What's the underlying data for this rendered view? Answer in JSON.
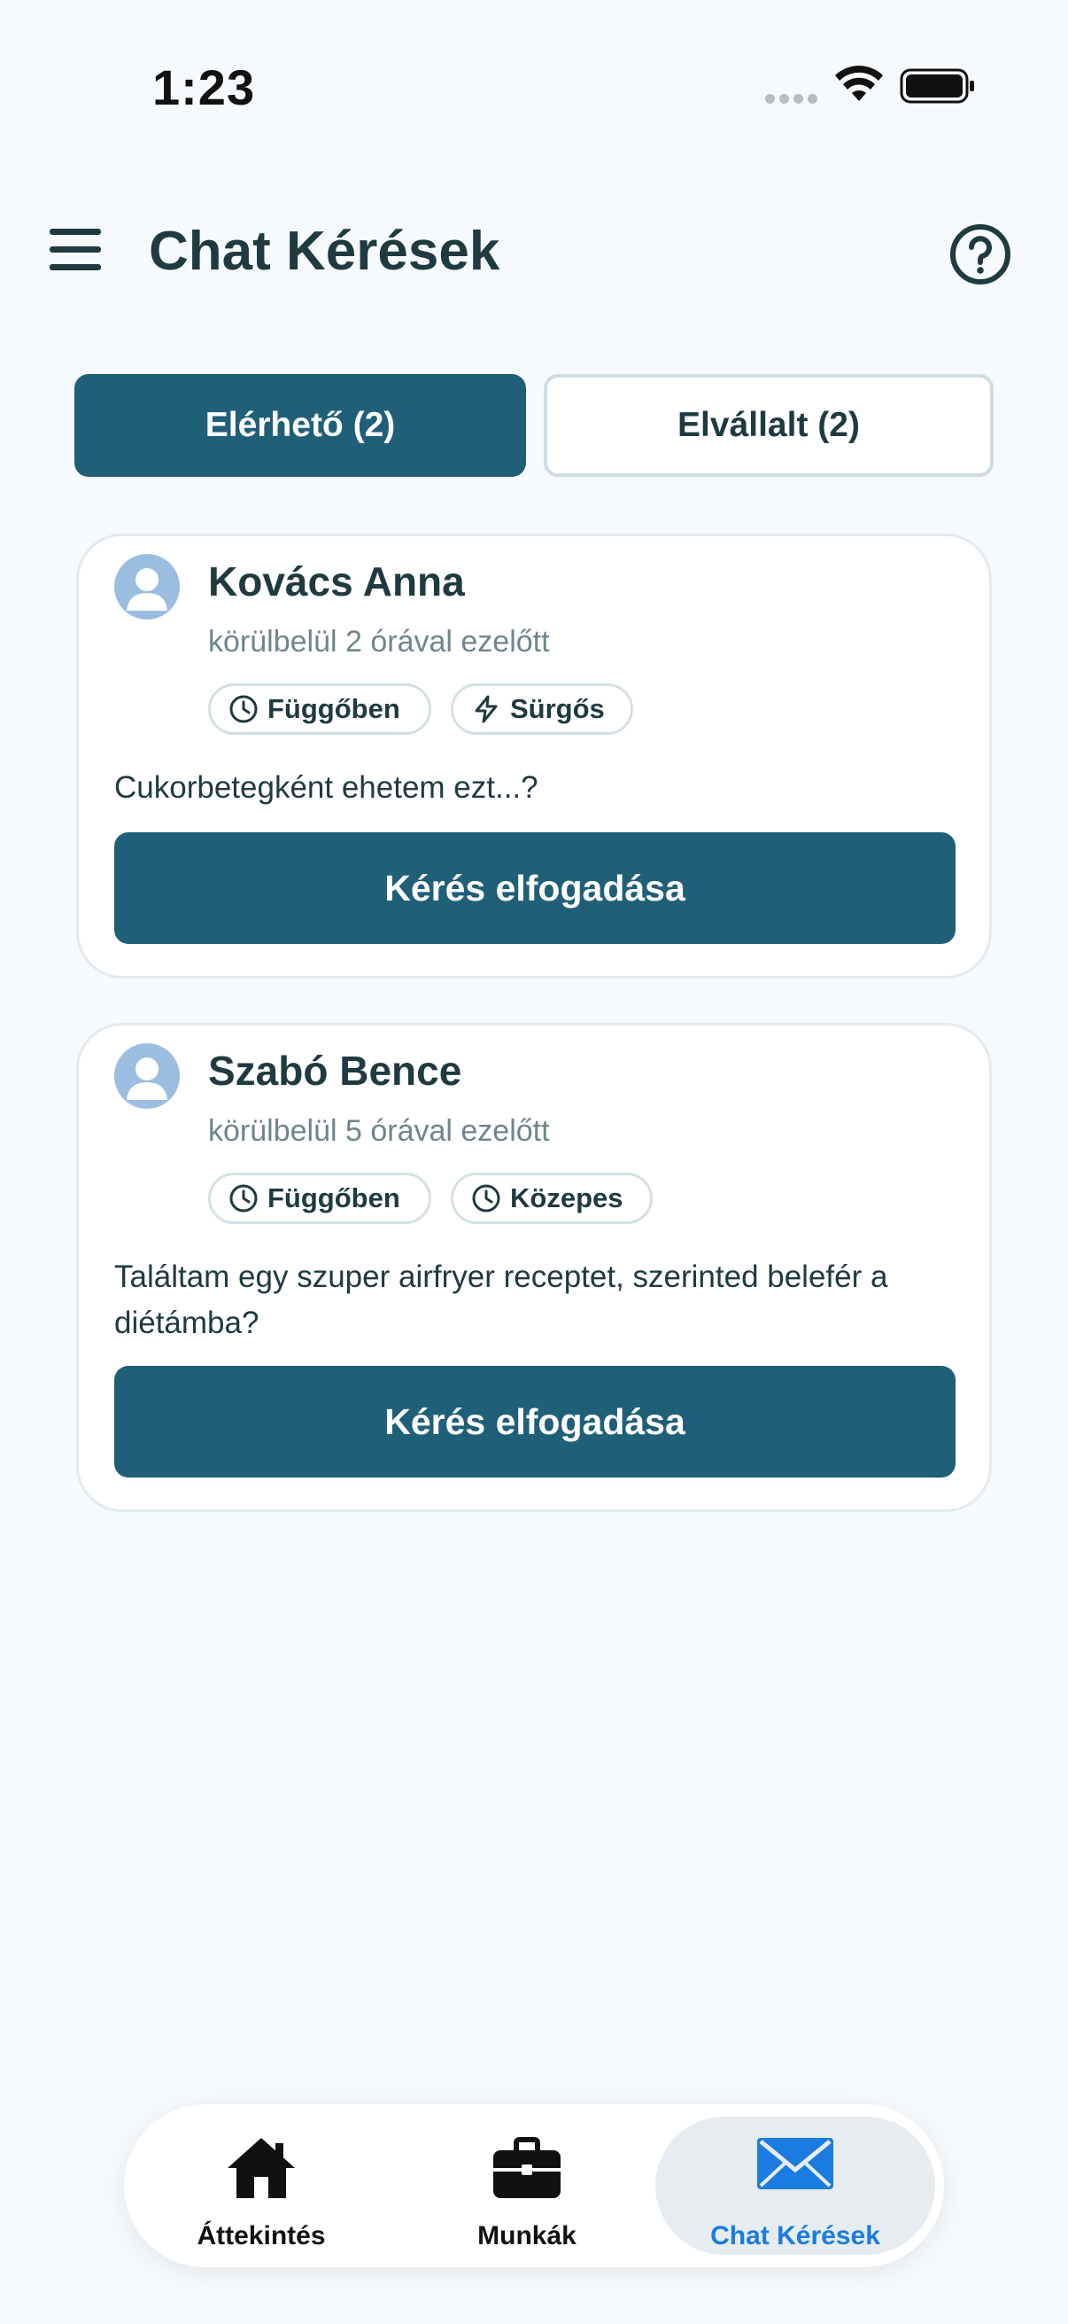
{
  "status_bar": {
    "time": "1:23"
  },
  "header": {
    "title": "Chat Kérések"
  },
  "tabs": [
    {
      "label": "Elérhető (2)",
      "active": true
    },
    {
      "label": "Elvállalt (2)",
      "active": false
    }
  ],
  "requests": [
    {
      "name": "Kovács Anna",
      "time_ago": "körülbelül 2 órával ezelőtt",
      "status_badge": "Függőben",
      "priority_badge": "Sürgős",
      "priority_icon": "lightning-icon",
      "message": "Cukorbetegként ehetem ezt...?",
      "accept_label": "Kérés elfogadása"
    },
    {
      "name": "Szabó Bence",
      "time_ago": "körülbelül 5 órával ezelőtt",
      "status_badge": "Függőben",
      "priority_badge": "Közepes",
      "priority_icon": "clock-icon",
      "message": "Találtam egy szuper airfryer receptet, szerinted belefér a diétámba?",
      "accept_label": "Kérés elfogadása"
    }
  ],
  "bottom_nav": [
    {
      "label": "Áttekintés",
      "icon": "home-icon",
      "active": false
    },
    {
      "label": "Munkák",
      "icon": "briefcase-icon",
      "active": false
    },
    {
      "label": "Chat Kérések",
      "icon": "envelope-icon",
      "active": true
    }
  ],
  "colors": {
    "primary": "#1f5f78",
    "text": "#1f3a40",
    "muted": "#6f858a",
    "background": "#f7fafc",
    "active_nav": "#1a7ce0"
  }
}
